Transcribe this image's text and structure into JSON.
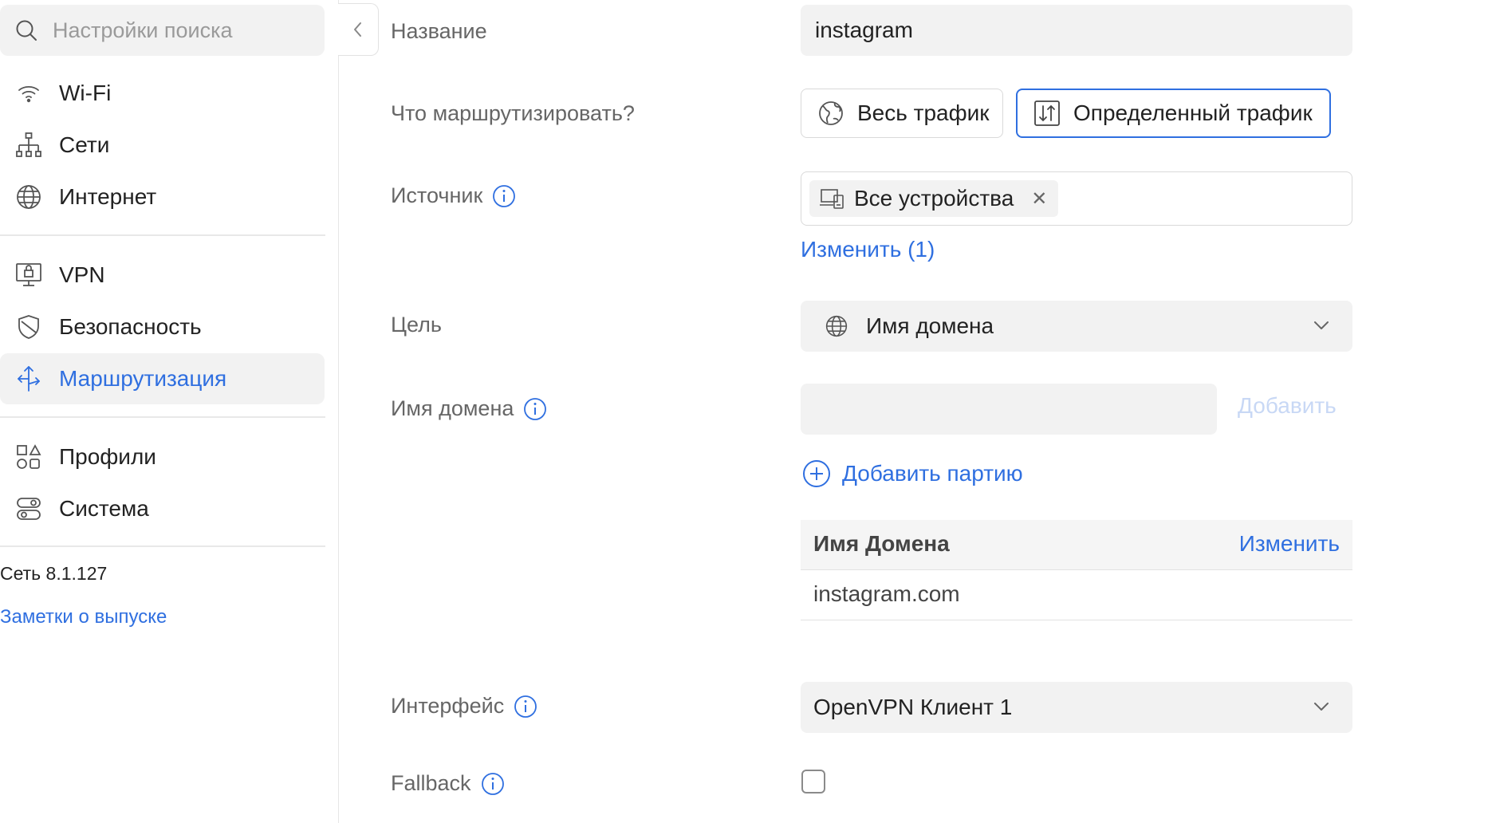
{
  "sidebar": {
    "search_placeholder": "Настройки поиска",
    "items": [
      {
        "label": "Wi-Fi",
        "icon": "wifi-icon"
      },
      {
        "label": "Сети",
        "icon": "network-tree-icon"
      },
      {
        "label": "Интернет",
        "icon": "globe-icon"
      },
      {
        "label": "VPN",
        "icon": "vpn-monitor-icon"
      },
      {
        "label": "Безопасность",
        "icon": "shield-icon"
      },
      {
        "label": "Маршрутизация",
        "icon": "routing-icon",
        "active": true
      },
      {
        "label": "Профили",
        "icon": "profiles-grid-icon"
      },
      {
        "label": "Система",
        "icon": "system-toggles-icon"
      }
    ],
    "version": "Сеть 8.1.127",
    "release_notes": "Заметки о выпуске"
  },
  "form": {
    "name": {
      "label": "Название",
      "value": "instagram"
    },
    "route_what": {
      "label": "Что маршрутизировать?",
      "options": [
        "Весь трафик",
        "Определенный трафик"
      ],
      "selected": "Определенный трафик"
    },
    "source": {
      "label": "Источник",
      "chip": "Все устройства",
      "change_link": "Изменить (1)"
    },
    "target": {
      "label": "Цель",
      "value": "Имя домена"
    },
    "domain_name": {
      "label": "Имя домена",
      "value": "",
      "add_button": "Добавить",
      "add_batch": "Добавить партию"
    },
    "domain_table": {
      "header": "Имя Домена",
      "edit": "Изменить",
      "rows": [
        "instagram.com"
      ]
    },
    "interface": {
      "label": "Интерфейс",
      "value": "OpenVPN Клиент 1"
    },
    "fallback": {
      "label": "Fallback",
      "checked": false
    }
  },
  "colors": {
    "accent": "#2f6fe0",
    "field_bg": "#f2f2f2",
    "label": "#666666"
  }
}
